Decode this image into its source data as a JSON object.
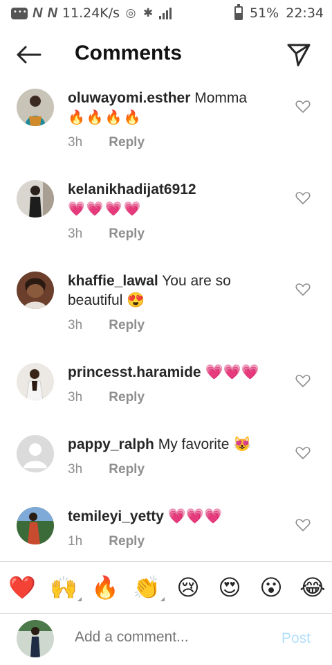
{
  "status_bar": {
    "network_speed": "11.24K/s",
    "battery": "51%",
    "time": "22:34"
  },
  "header": {
    "title": "Comments"
  },
  "comments": [
    {
      "username": "oluwayomi.esther",
      "text": "Momma",
      "emojis": "🔥🔥🔥🔥",
      "time": "3h",
      "reply": "Reply"
    },
    {
      "username": "kelanikhadijat6912",
      "text": "",
      "emojis": "💗💗💗💗",
      "time": "3h",
      "reply": "Reply"
    },
    {
      "username": "khaffie_lawal",
      "text": "You are so beautiful 😍",
      "emojis": "",
      "time": "3h",
      "reply": "Reply"
    },
    {
      "username": "princesst.haramide",
      "text": "💗💗💗",
      "emojis": "",
      "time": "3h",
      "reply": "Reply"
    },
    {
      "username": "pappy_ralph",
      "text": "My favorite 😻",
      "emojis": "",
      "time": "3h",
      "reply": "Reply"
    },
    {
      "username": "temileyi_yetty",
      "text": "💗💗💗",
      "emojis": "",
      "time": "1h",
      "reply": "Reply"
    }
  ],
  "emoji_bar": [
    "❤️",
    "🙌",
    "🔥",
    "👏",
    "😢",
    "😍",
    "😮",
    "😂"
  ],
  "composer": {
    "placeholder": "Add a comment...",
    "post_label": "Post"
  },
  "colors": {
    "heart_pink": "#e0569a",
    "reply_grey": "#8e8e8e",
    "post_disabled": "#b2dffc"
  }
}
